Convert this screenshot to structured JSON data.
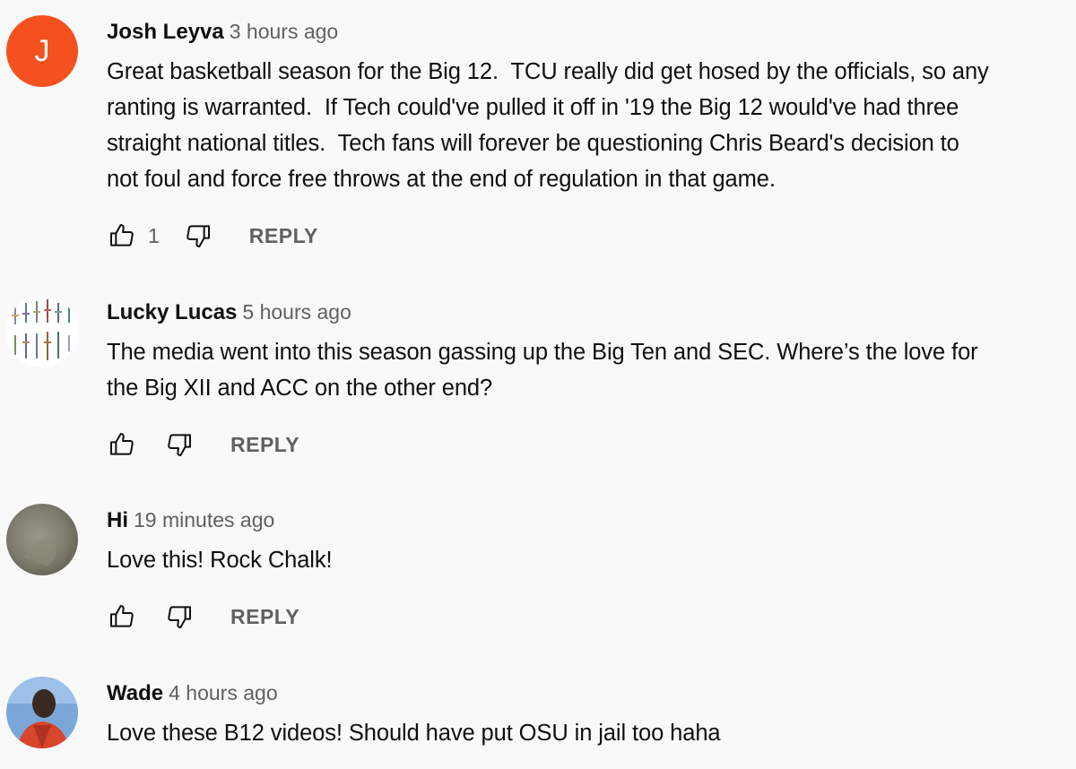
{
  "comments": [
    {
      "author": "Josh Leyva",
      "time": "3 hours ago",
      "text": "Great basketball season for the Big 12.  TCU really did get hosed by the officials, so any\nranting is warranted.  If Tech could've pulled it off in '19 the Big 12 would've had three\nstraight national titles.  Tech fans will forever be questioning Chris Beard's decision to\nnot foul and force free throws at the end of regulation in that game.",
      "avatar_letter": "J",
      "avatar_color": "#f4511e",
      "likes": "1",
      "reply_label": "REPLY"
    },
    {
      "author": "Lucky Lucas",
      "time": "5 hours ago",
      "text": "The media went into this season gassing up the Big Ten and SEC. Where’s the love for\nthe Big XII and ACC on the other end?",
      "avatar": "swords-image",
      "reply_label": "REPLY"
    },
    {
      "author": "Hi",
      "time": "19 minutes ago",
      "text": "Love this! Rock Chalk!",
      "avatar": "gray-photo",
      "reply_label": "REPLY"
    },
    {
      "author": "Wade",
      "time": "4 hours ago",
      "text": "Love these B12 videos! Should have put OSU in jail too haha",
      "avatar": "person-photo"
    }
  ],
  "icons": {
    "like": "thumbs-up-icon",
    "dislike": "thumbs-down-icon"
  }
}
